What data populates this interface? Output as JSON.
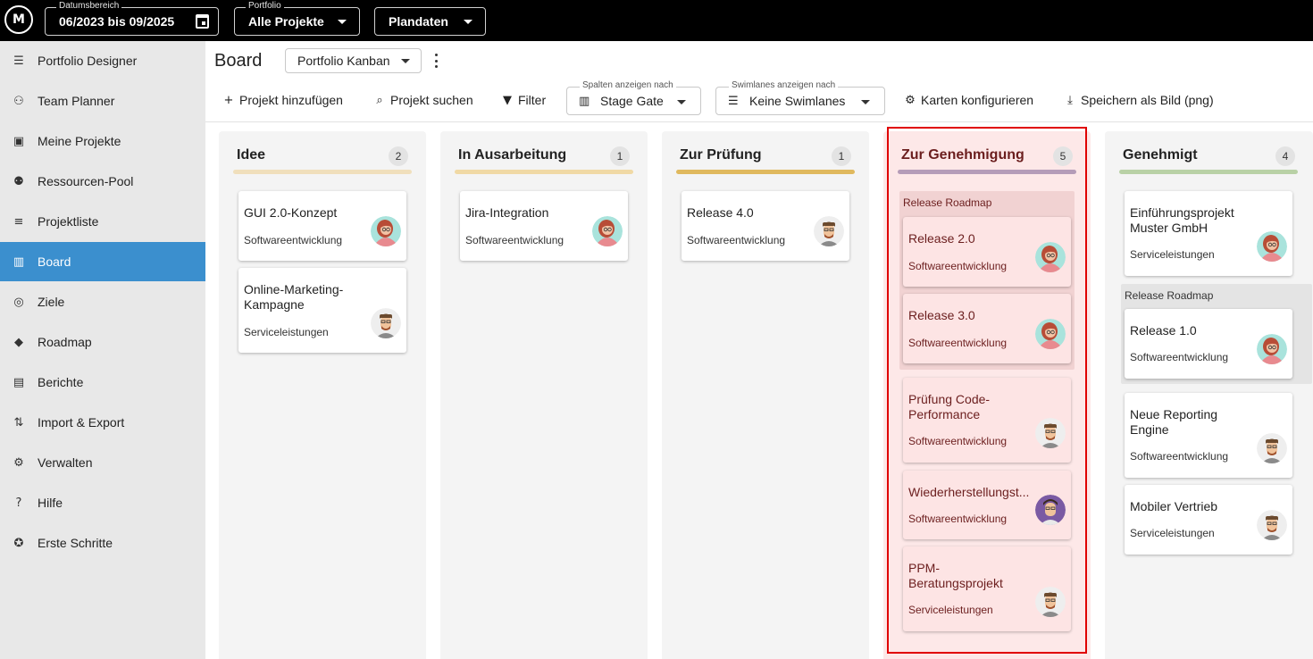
{
  "topbar": {
    "logo_text": "M",
    "date_range": {
      "label": "Datumsbereich",
      "value": "06/2023 bis 09/2025"
    },
    "portfolio": {
      "label": "Portfolio",
      "value": "Alle Projekte"
    },
    "data_mode": {
      "value": "Plandaten"
    }
  },
  "sidebar": {
    "items": [
      {
        "label": "Portfolio Designer",
        "icon": "portfolio-designer-icon"
      },
      {
        "label": "Team Planner",
        "icon": "team-planner-icon"
      },
      {
        "label": "Meine Projekte",
        "icon": "my-projects-icon"
      },
      {
        "label": "Ressourcen-Pool",
        "icon": "resource-pool-icon"
      },
      {
        "label": "Projektliste",
        "icon": "list-icon"
      },
      {
        "label": "Board",
        "icon": "board-icon",
        "active": true
      },
      {
        "label": "Ziele",
        "icon": "target-icon"
      },
      {
        "label": "Roadmap",
        "icon": "roadmap-icon"
      },
      {
        "label": "Berichte",
        "icon": "report-icon"
      },
      {
        "label": "Import & Export",
        "icon": "import-export-icon"
      },
      {
        "label": "Verwalten",
        "icon": "gear-icon"
      },
      {
        "label": "Hilfe",
        "icon": "help-icon"
      },
      {
        "label": "Erste Schritte",
        "icon": "compass-icon"
      }
    ]
  },
  "header": {
    "title": "Board",
    "board_select": "Portfolio Kanban"
  },
  "toolbar": {
    "add_project": "Projekt hinzufügen",
    "search_project": "Projekt suchen",
    "filter": "Filter",
    "columns_by": {
      "label": "Spalten anzeigen nach",
      "value": "Stage Gate"
    },
    "swimlanes_by": {
      "label": "Swimlanes anzeigen nach",
      "value": "Keine Swimlanes"
    },
    "configure_cards": "Karten konfigurieren",
    "save_image": "Speichern als Bild (png)"
  },
  "colors": {
    "accent": "#3b8fce",
    "idee": "#f0dfbc",
    "in_ausarbeitung": "#f0d9a5",
    "zur_pruefung": "#e0b95e",
    "zur_genehmigung": "#b59cb8",
    "genehmigt": "#b9d1a6",
    "highlight_frame": "#e00000"
  },
  "board": {
    "columns": [
      {
        "title": "Idee",
        "count": "2",
        "cards": [
          {
            "title": "GUI 2.0-Konzept",
            "tag": "Softwareentwicklung",
            "avatar": "woman-avatar"
          },
          {
            "title": "Online-Marketing-Kampagne",
            "tag": "Serviceleistungen",
            "avatar": "man-avatar"
          }
        ]
      },
      {
        "title": "In Ausarbeitung",
        "count": "1",
        "cards": [
          {
            "title": "Jira-Integration",
            "tag": "Softwareentwicklung",
            "avatar": "woman-avatar"
          }
        ]
      },
      {
        "title": "Zur Prüfung",
        "count": "1",
        "cards": [
          {
            "title": "Release 4.0",
            "tag": "Softwareentwicklung",
            "avatar": "man-avatar"
          }
        ]
      },
      {
        "title": "Zur Genehmigung",
        "count": "5",
        "group_label": "Release Roadmap",
        "cards": [
          {
            "title": "Release 2.0",
            "tag": "Softwareentwicklung",
            "avatar": "woman-avatar"
          },
          {
            "title": "Release 3.0",
            "tag": "Softwareentwicklung",
            "avatar": "woman-avatar"
          },
          {
            "title": "Prüfung Code-Performance",
            "tag": "Softwareentwicklung",
            "avatar": "man-avatar"
          },
          {
            "title": "Wiederherstellungst...",
            "tag": "Softwareentwicklung",
            "avatar": "man-purple-avatar"
          },
          {
            "title": "PPM-Beratungsprojekt",
            "tag": "Serviceleistungen",
            "avatar": "man-avatar"
          }
        ]
      },
      {
        "title": "Genehmigt",
        "count": "4",
        "group_label": "Release Roadmap",
        "cards": [
          {
            "title": "Einführungsprojekt Muster GmbH",
            "tag": "Serviceleistungen",
            "avatar": "woman-avatar"
          },
          {
            "title": "Release 1.0",
            "tag": "Softwareentwicklung",
            "avatar": "woman-avatar"
          },
          {
            "title": "Neue Reporting Engine",
            "tag": "Softwareentwicklung",
            "avatar": "man-avatar"
          },
          {
            "title": "Mobiler Vertrieb",
            "tag": "Serviceleistungen",
            "avatar": "man-avatar"
          }
        ]
      }
    ]
  }
}
